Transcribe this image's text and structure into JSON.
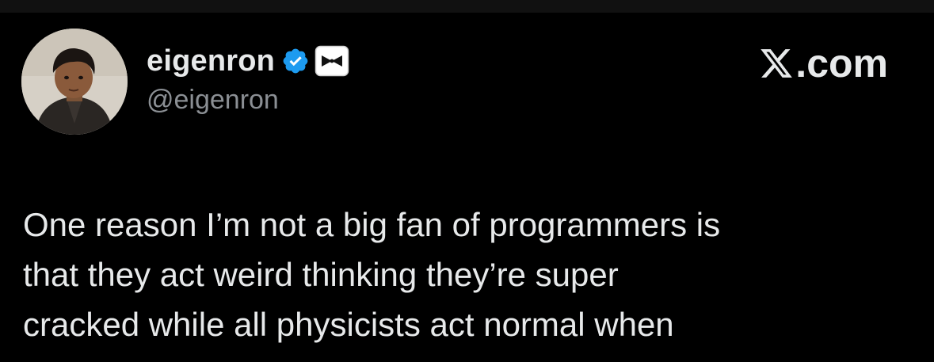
{
  "author": {
    "display_name": "eigenron",
    "handle": "@eigenron",
    "avatar_icon": "person-photo-avatar",
    "verified_icon": "verified-badge-icon",
    "affiliate_icon": "affiliate-badge-icon"
  },
  "brand": {
    "label": ".com",
    "icon": "x-logo-icon"
  },
  "tweet": {
    "lines": [
      "One reason I’m not a big fan of programmers is",
      "that they act weird thinking they’re super",
      "cracked while all physicists act normal when"
    ]
  },
  "colors": {
    "background": "#000000",
    "text": "#e7e9ea",
    "secondary_text": "#8b8f94",
    "verified_blue": "#1d9bf0"
  }
}
